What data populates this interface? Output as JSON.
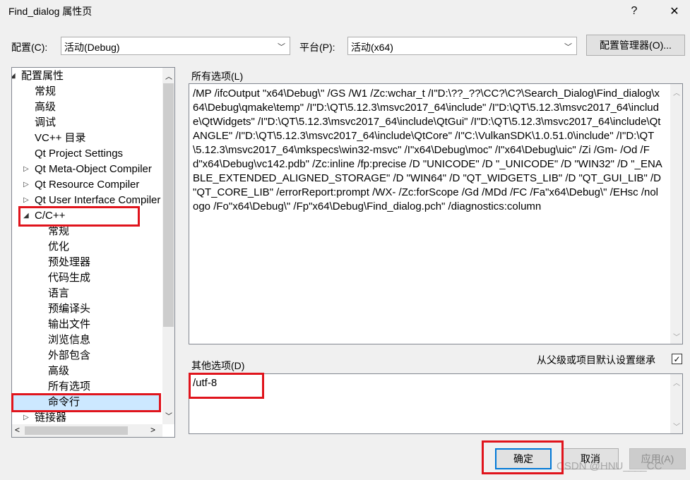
{
  "window": {
    "title": "Find_dialog 属性页",
    "help_icon": "?",
    "close_icon": "✕"
  },
  "config": {
    "label": "配置(C):",
    "value": "活动(Debug)"
  },
  "platform": {
    "label": "平台(P):",
    "value": "活动(x64)"
  },
  "config_manager_label": "配置管理器(O)...",
  "tree": {
    "items": [
      {
        "label": "配置属性",
        "expander": "◢"
      },
      {
        "label": "常规"
      },
      {
        "label": "高级"
      },
      {
        "label": "调试"
      },
      {
        "label": "VC++ 目录"
      },
      {
        "label": "Qt Project Settings"
      },
      {
        "label": "Qt Meta-Object Compiler",
        "expander": "▷"
      },
      {
        "label": "Qt Resource Compiler",
        "expander": "▷"
      },
      {
        "label": "Qt User Interface Compiler",
        "expander": "▷"
      },
      {
        "label": "C/C++",
        "expander": "◢"
      },
      {
        "label": "常规"
      },
      {
        "label": "优化"
      },
      {
        "label": "预处理器"
      },
      {
        "label": "代码生成"
      },
      {
        "label": "语言"
      },
      {
        "label": "预编译头"
      },
      {
        "label": "输出文件"
      },
      {
        "label": "浏览信息"
      },
      {
        "label": "外部包含"
      },
      {
        "label": "高级"
      },
      {
        "label": "所有选项"
      },
      {
        "label": "命令行",
        "selected": true
      },
      {
        "label": "链接器",
        "expander": "▷"
      }
    ]
  },
  "all_options": {
    "label": "所有选项(L)",
    "text": "/MP /ifcOutput \"x64\\Debug\\\" /GS /W1 /Zc:wchar_t /I\"D:\\??_??\\CC?\\C?\\Search_Dialog\\Find_dialog\\x64\\Debug\\qmake\\temp\" /I\"D:\\QT\\5.12.3\\msvc2017_64\\include\" /I\"D:\\QT\\5.12.3\\msvc2017_64\\include\\QtWidgets\" /I\"D:\\QT\\5.12.3\\msvc2017_64\\include\\QtGui\" /I\"D:\\QT\\5.12.3\\msvc2017_64\\include\\QtANGLE\" /I\"D:\\QT\\5.12.3\\msvc2017_64\\include\\QtCore\" /I\"C:\\VulkanSDK\\1.0.51.0\\include\" /I\"D:\\QT\\5.12.3\\msvc2017_64\\mkspecs\\win32-msvc\" /I\"x64\\Debug\\moc\" /I\"x64\\Debug\\uic\" /Zi /Gm- /Od /Fd\"x64\\Debug\\vc142.pdb\" /Zc:inline /fp:precise /D \"UNICODE\" /D \"_UNICODE\" /D \"WIN32\" /D \"_ENABLE_EXTENDED_ALIGNED_STORAGE\" /D \"WIN64\" /D \"QT_WIDGETS_LIB\" /D \"QT_GUI_LIB\" /D \"QT_CORE_LIB\" /errorReport:prompt /WX- /Zc:forScope /Gd /MDd /FC /Fa\"x64\\Debug\\\" /EHsc /nologo /Fo\"x64\\Debug\\\" /Fp\"x64\\Debug\\Find_dialog.pch\" /diagnostics:column"
  },
  "inherit_label": "从父级或项目默认设置继承",
  "other_options": {
    "label": "其他选项(D)",
    "value": "/utf-8"
  },
  "buttons": {
    "ok": "确定",
    "cancel": "取消",
    "apply": "应用(A)"
  },
  "watermark": "CSDN @HNU____CC"
}
